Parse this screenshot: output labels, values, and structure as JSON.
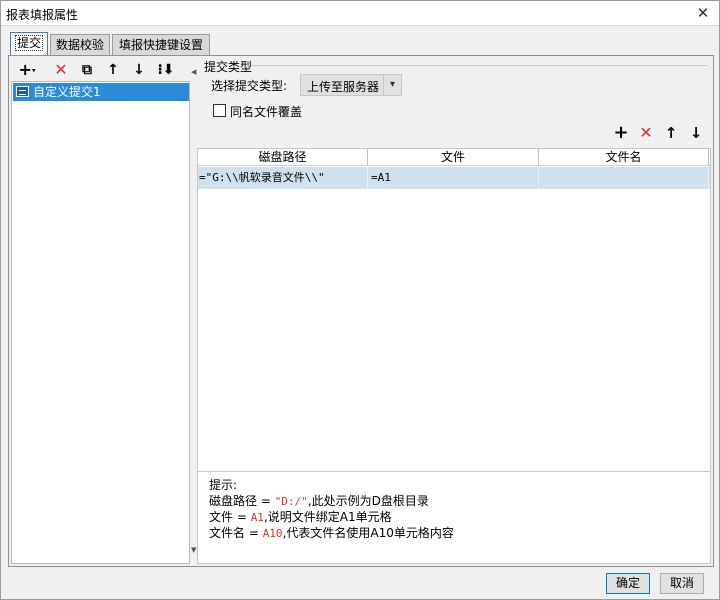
{
  "window": {
    "title": "报表填报属性",
    "close_glyph": "✕"
  },
  "tabs": [
    {
      "label": "提交",
      "active": true
    },
    {
      "label": "数据校验",
      "active": false
    },
    {
      "label": "填报快捷键设置",
      "active": false
    }
  ],
  "left_toolbar": {
    "add_icon": "plus-dropdown-icon",
    "add_glyph": "+",
    "delete_glyph": "✕",
    "copy_glyph": "⧉",
    "up_glyph": "↑",
    "down_glyph": "↓",
    "more_glyph": "⁝⬇"
  },
  "submit_list": [
    {
      "label": "自定义提交1",
      "selected": true
    }
  ],
  "submit_type": {
    "section_label": "提交类型",
    "select_label": "选择提交类型:",
    "selected_value": "上传至服务器",
    "overwrite_label": "同名文件覆盖",
    "overwrite_checked": false
  },
  "right_toolbar": {
    "add_glyph": "+",
    "delete_glyph": "✕",
    "up_glyph": "↑",
    "down_glyph": "↓"
  },
  "table": {
    "columns": [
      "磁盘路径",
      "文件",
      "文件名"
    ],
    "rows": [
      {
        "path": "=\"G:\\\\帆软录音文件\\\\\"",
        "file": "=A1",
        "filename": ""
      }
    ]
  },
  "hint": {
    "title": "提示:",
    "line1_prefix": "磁盘路径 = ",
    "line1_code": "\"D:/\"",
    "line1_suffix": ",此处示例为D盘根目录",
    "line2_prefix": "文件 = ",
    "line2_code": "A1",
    "line2_suffix": ",说明文件绑定A1单元格",
    "line3_prefix": "文件名 = ",
    "line3_code": "A10",
    "line3_suffix": ",代表文件名使用A10单元格内容"
  },
  "footer": {
    "ok_label": "确定",
    "cancel_label": "取消"
  },
  "colors": {
    "accent": "#2a8bd9",
    "delete": "#e03030",
    "row_selected": "#cfe0ef"
  }
}
